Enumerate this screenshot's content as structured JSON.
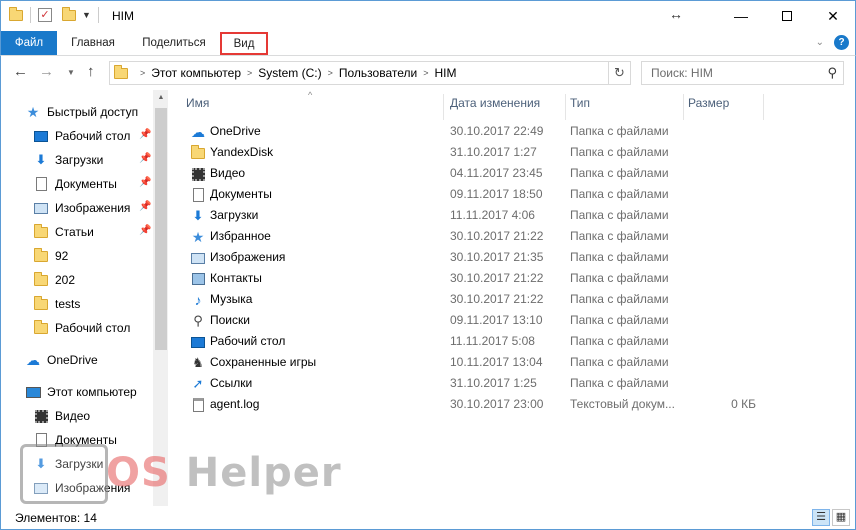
{
  "window": {
    "title": "HIM"
  },
  "ribbon": {
    "tabs": [
      {
        "label": "Файл"
      },
      {
        "label": "Главная"
      },
      {
        "label": "Поделиться"
      },
      {
        "label": "Вид"
      }
    ]
  },
  "address": {
    "crumbs": [
      "Этот компьютер",
      "System (C:)",
      "Пользователи",
      "HIM"
    ],
    "search_placeholder": "Поиск: HIM"
  },
  "nav": {
    "items": [
      {
        "label": "Быстрый доступ",
        "icon": "star-icon",
        "pinned": false,
        "indent": 1
      },
      {
        "label": "Рабочий стол",
        "icon": "desktop-icon",
        "pinned": true,
        "indent": 2
      },
      {
        "label": "Загрузки",
        "icon": "download-icon",
        "pinned": true,
        "indent": 2
      },
      {
        "label": "Документы",
        "icon": "document-icon",
        "pinned": true,
        "indent": 2
      },
      {
        "label": "Изображения",
        "icon": "image-icon",
        "pinned": true,
        "indent": 2
      },
      {
        "label": "Статьи",
        "icon": "folder-icon",
        "pinned": true,
        "indent": 2
      },
      {
        "label": "92",
        "icon": "folder-icon",
        "pinned": false,
        "indent": 2
      },
      {
        "label": "202",
        "icon": "folder-icon",
        "pinned": false,
        "indent": 2
      },
      {
        "label": "tests",
        "icon": "folder-icon",
        "pinned": false,
        "indent": 2
      },
      {
        "label": "Рабочий стол",
        "icon": "folder-icon",
        "pinned": false,
        "indent": 2
      },
      {
        "label": "OneDrive",
        "icon": "cloud-icon",
        "pinned": false,
        "indent": 1
      },
      {
        "label": "Этот компьютер",
        "icon": "computer-icon",
        "pinned": false,
        "indent": 1
      },
      {
        "label": "Видео",
        "icon": "video-icon",
        "pinned": false,
        "indent": 2
      },
      {
        "label": "Документы",
        "icon": "document-icon",
        "pinned": false,
        "indent": 2
      },
      {
        "label": "Загрузки",
        "icon": "download-icon",
        "pinned": false,
        "indent": 2
      },
      {
        "label": "Изображения",
        "icon": "image-icon",
        "pinned": false,
        "indent": 2
      }
    ]
  },
  "list": {
    "columns": [
      "Имя",
      "Дата изменения",
      "Тип",
      "Размер"
    ],
    "rows": [
      {
        "name": "OneDrive",
        "date": "30.10.2017 22:49",
        "type": "Папка с файлами",
        "size": "",
        "icon": "cloud-icon"
      },
      {
        "name": "YandexDisk",
        "date": "31.10.2017 1:27",
        "type": "Папка с файлами",
        "size": "",
        "icon": "folder-icon"
      },
      {
        "name": "Видео",
        "date": "04.11.2017 23:45",
        "type": "Папка с файлами",
        "size": "",
        "icon": "video-icon"
      },
      {
        "name": "Документы",
        "date": "09.11.2017 18:50",
        "type": "Папка с файлами",
        "size": "",
        "icon": "document-icon"
      },
      {
        "name": "Загрузки",
        "date": "11.11.2017 4:06",
        "type": "Папка с файлами",
        "size": "",
        "icon": "download-icon"
      },
      {
        "name": "Избранное",
        "date": "30.10.2017 21:22",
        "type": "Папка с файлами",
        "size": "",
        "icon": "star-icon"
      },
      {
        "name": "Изображения",
        "date": "30.10.2017 21:35",
        "type": "Папка с файлами",
        "size": "",
        "icon": "image-icon"
      },
      {
        "name": "Контакты",
        "date": "30.10.2017 21:22",
        "type": "Папка с файлами",
        "size": "",
        "icon": "contacts-icon"
      },
      {
        "name": "Музыка",
        "date": "30.10.2017 21:22",
        "type": "Папка с файлами",
        "size": "",
        "icon": "music-icon"
      },
      {
        "name": "Поиски",
        "date": "09.11.2017 13:10",
        "type": "Папка с файлами",
        "size": "",
        "icon": "search-icon"
      },
      {
        "name": "Рабочий стол",
        "date": "11.11.2017 5:08",
        "type": "Папка с файлами",
        "size": "",
        "icon": "desktop-icon"
      },
      {
        "name": "Сохраненные игры",
        "date": "10.11.2017 13:04",
        "type": "Папка с файлами",
        "size": "",
        "icon": "game-icon"
      },
      {
        "name": "Ссылки",
        "date": "31.10.2017 1:25",
        "type": "Папка с файлами",
        "size": "",
        "icon": "link-icon"
      },
      {
        "name": "agent.log",
        "date": "30.10.2017 23:00",
        "type": "Текстовый докум...",
        "size": "0 КБ",
        "icon": "text-file-icon"
      }
    ]
  },
  "status": {
    "text": "Элементов: 14"
  },
  "watermark": {
    "os": "OS",
    "helper": "Helper"
  },
  "colors": {
    "accent": "#1979ca",
    "highlight": "#e53935",
    "folder": "#f8d775",
    "window_border": "#5b9bd5"
  }
}
